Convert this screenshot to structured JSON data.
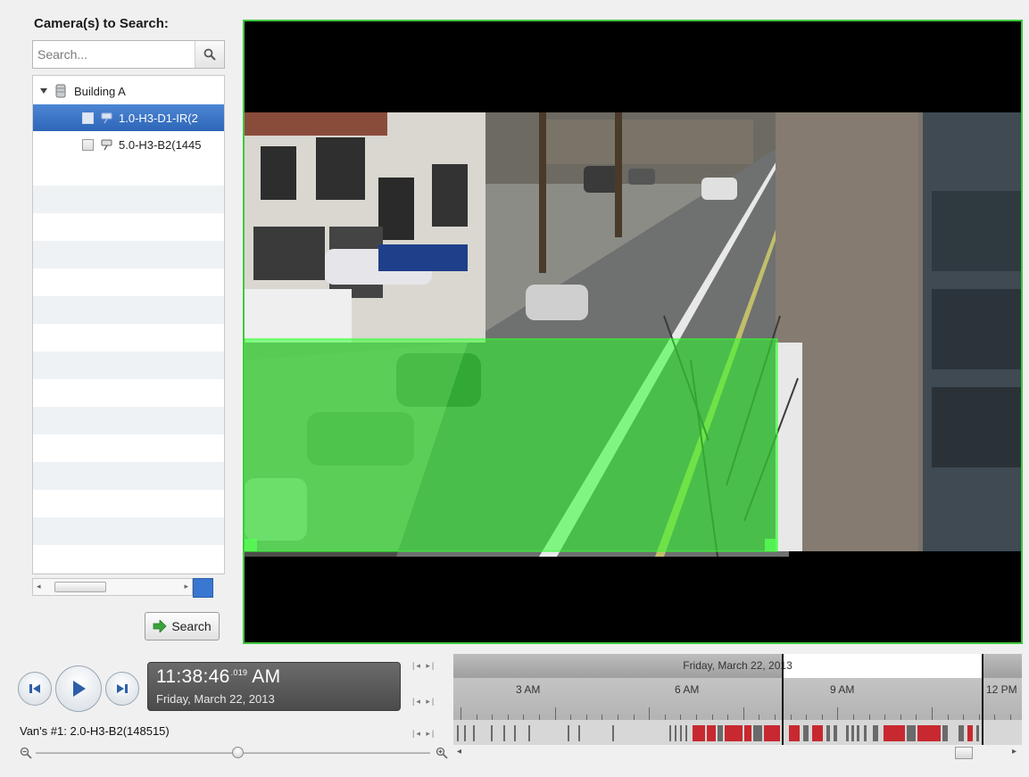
{
  "left_panel": {
    "title": "Camera(s) to Search:",
    "search_placeholder": "Search...",
    "tree": {
      "group_label": "Building A",
      "cameras": [
        {
          "label": "1.0-H3-D1-IR(2",
          "selected": true
        },
        {
          "label": "5.0-H3-B2(1445",
          "selected": false
        }
      ]
    },
    "search_button_label": "Search"
  },
  "player": {
    "time": "11:38:46",
    "milliseconds": ".019",
    "ampm": "AM",
    "date": "Friday, March 22, 2013",
    "camera_label": "Van's #1: 2.0-H3-B2(148515)"
  },
  "timeline": {
    "date_label": "Friday, March 22, 2013",
    "hour_labels": [
      "3 AM",
      "6 AM",
      "9 AM",
      "12 PM"
    ]
  },
  "colors": {
    "selection_blue": "#3570c4",
    "motion_overlay": "#2bff2b",
    "frame_border": "#3fc83f",
    "recording_gray": "#6a6a6a",
    "recording_red": "#c8282f"
  },
  "icons": {
    "search": "search-icon",
    "expand": "expand-triangle-icon",
    "building": "building-icon",
    "camera": "camera-icon",
    "search_arrow": "green-arrow-icon",
    "step_back": "step-back-icon",
    "play": "play-icon",
    "step_forward": "step-forward-icon",
    "zoom_out": "zoom-out-icon",
    "zoom_in": "zoom-in-icon"
  }
}
